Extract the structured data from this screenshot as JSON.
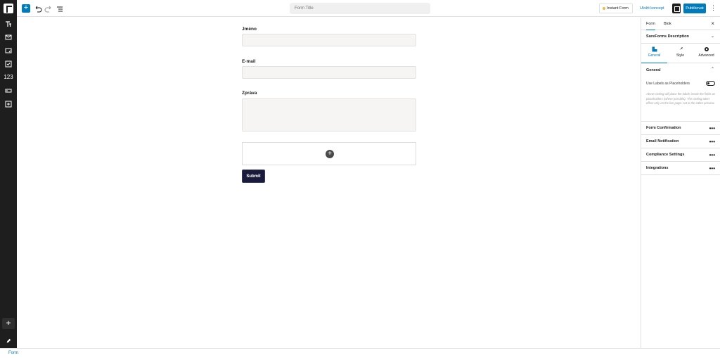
{
  "topbar": {
    "form_title_placeholder": "Form Title",
    "instant_form_label": "Instant Form",
    "save_draft_label": "Uložit koncept",
    "publish_label": "Publikovat"
  },
  "leftbar": {
    "numeric_label": "123"
  },
  "form": {
    "fields": [
      {
        "label": "Jméno"
      },
      {
        "label": "E-mail"
      },
      {
        "label": "Zpráva"
      }
    ],
    "submit_label": "Submit"
  },
  "sidebar": {
    "tabs": [
      {
        "label": "Form"
      },
      {
        "label": "Blok"
      }
    ],
    "description_label": "SureForms Description",
    "subtabs": [
      {
        "label": "General"
      },
      {
        "label": "Style"
      },
      {
        "label": "Advanced"
      }
    ],
    "general": {
      "heading": "General",
      "toggle_label": "Use Labels as Placeholders",
      "help_text": "Above setting will place the labels inside the fields as placeholders (where possible). This setting takes effect only on the live page, not in the editor preview."
    },
    "sections": [
      {
        "label": "Form Confirmation"
      },
      {
        "label": "Email Notification"
      },
      {
        "label": "Compliance Settings"
      },
      {
        "label": "Integrations"
      }
    ]
  },
  "statusbar": {
    "breadcrumb": "Form"
  },
  "colors": {
    "accent": "#007cba",
    "submit_bg": "#1a1a3a",
    "dark_bar": "#1e1e1e"
  }
}
